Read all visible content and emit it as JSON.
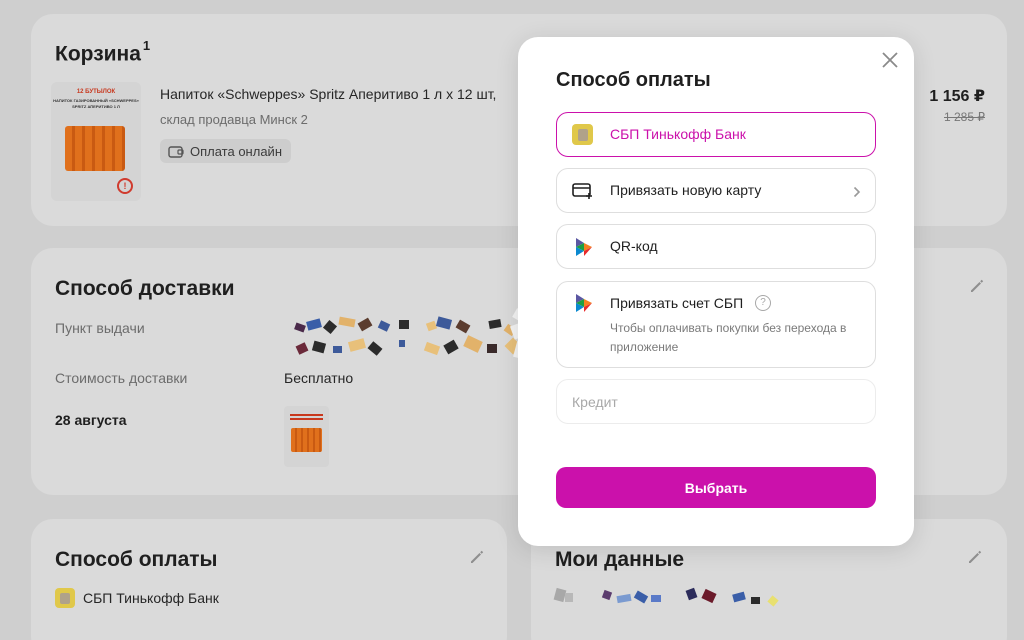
{
  "cart": {
    "title": "Корзина",
    "count": "1",
    "product_name": "Напиток «Schweppes» Spritz Аперитиво 1 л х 12 шт,",
    "warehouse": "склад продавца Минск 2",
    "payment_badge": "Оплата онлайн",
    "price": "1 156 ₽",
    "old_price": "1 285 ₽",
    "thumb_line1": "12 БУТЫЛОК",
    "thumb_line2": "НАПИТОК ГАЗИРОВАННЫЙ «SCHWEPPES»",
    "thumb_line3": "SPRITZ АПЕРИТИВО 1 Л"
  },
  "delivery": {
    "title": "Способ доставки",
    "pickup_label": "Пункт выдачи",
    "cost_label": "Стоимость доставки",
    "cost_value": "Бесплатно",
    "date": "28 августа"
  },
  "payment_card": {
    "title": "Способ оплаты",
    "selected": "СБП Тинькофф Банк"
  },
  "my_data": {
    "title": "Мои данные"
  },
  "modal": {
    "title": "Способ оплаты",
    "options": [
      {
        "label": "СБП Тинькофф Банк",
        "icon": "bank-logo-icon"
      },
      {
        "label": "Привязать новую карту",
        "icon": "card-add-icon"
      },
      {
        "label": "QR-код",
        "icon": "sbp-icon"
      },
      {
        "label": "Привязать счет СБП",
        "icon": "sbp-icon",
        "subtitle": "Чтобы оплачивать покупки без перехода в приложение"
      },
      {
        "label": "Кредит"
      }
    ],
    "confirm_button": "Выбрать"
  },
  "colors": {
    "accent": "#cb11ab",
    "selected_text": "#cb11ab"
  }
}
